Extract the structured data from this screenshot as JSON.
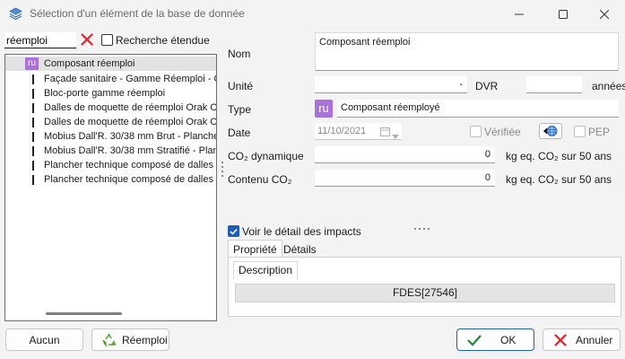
{
  "window": {
    "title": "Sélection d'un élément de la base de donnée",
    "icon": "layers-app-icon"
  },
  "search": {
    "value": "réemploi",
    "extended_label": "Recherche étendue",
    "extended_checked": false
  },
  "tree": {
    "items": [
      {
        "label": "Composant réemploi",
        "kind": "ru",
        "selected": true
      },
      {
        "label": "Façade sanitaire - Gamme Réemploi - CO",
        "kind": "line"
      },
      {
        "label": "Bloc-porte gamme réemploi",
        "kind": "line"
      },
      {
        "label": "Dalles de moquette de réemploi Orak Op",
        "kind": "line"
      },
      {
        "label": "Dalles de moquette de réemploi Orak Op",
        "kind": "line"
      },
      {
        "label": "Mobius Dall'R. 30/38 mm Brut - Plancher t",
        "kind": "line"
      },
      {
        "label": "Mobius Dall'R. 30/38 mm Stratifié - Planch",
        "kind": "line"
      },
      {
        "label": "Plancher technique composé de dalles de",
        "kind": "line"
      },
      {
        "label": "Plancher technique composé de dalles de",
        "kind": "line"
      }
    ]
  },
  "form": {
    "nom_label": "Nom",
    "nom_value": "Composant réemploi",
    "unite_label": "Unité",
    "unite_value": "-",
    "dvr_label": "DVR",
    "dvr_value": "",
    "annees_label": "années",
    "type_label": "Type",
    "type_icon": "ru",
    "type_value": "Composant réemployé",
    "date_label": "Date",
    "date_value": "11/10/2021",
    "verifiee_label": "Vérifiée",
    "pep_label": "PEP",
    "co2_dyn_label": "CO₂ dynamique",
    "co2_dyn_value": "0",
    "co2_dyn_unit": "kg eq. CO₂ sur 50 ans",
    "co2_contenu_label": "Contenu CO₂",
    "co2_contenu_value": "0",
    "co2_contenu_unit": "kg eq. CO₂ sur 50 ans"
  },
  "impacts": {
    "checkbox_label": "Voir le détail des impacts",
    "checked": true,
    "tabs": [
      "Propriété",
      "Détails"
    ],
    "active_tab": "Propriété",
    "sub_tab": "Description",
    "description_value": "FDES[27546]"
  },
  "buttons": {
    "aucun": "Aucun",
    "reemploi": "Réemploi",
    "ok": "OK",
    "annuler": "Annuler"
  },
  "colors": {
    "accent": "#1d5fb8",
    "ru_badge": "#a972d8",
    "cancel_red": "#e0242b",
    "ok_green": "#1f8a3a",
    "recycle_green": "#5db43f"
  }
}
